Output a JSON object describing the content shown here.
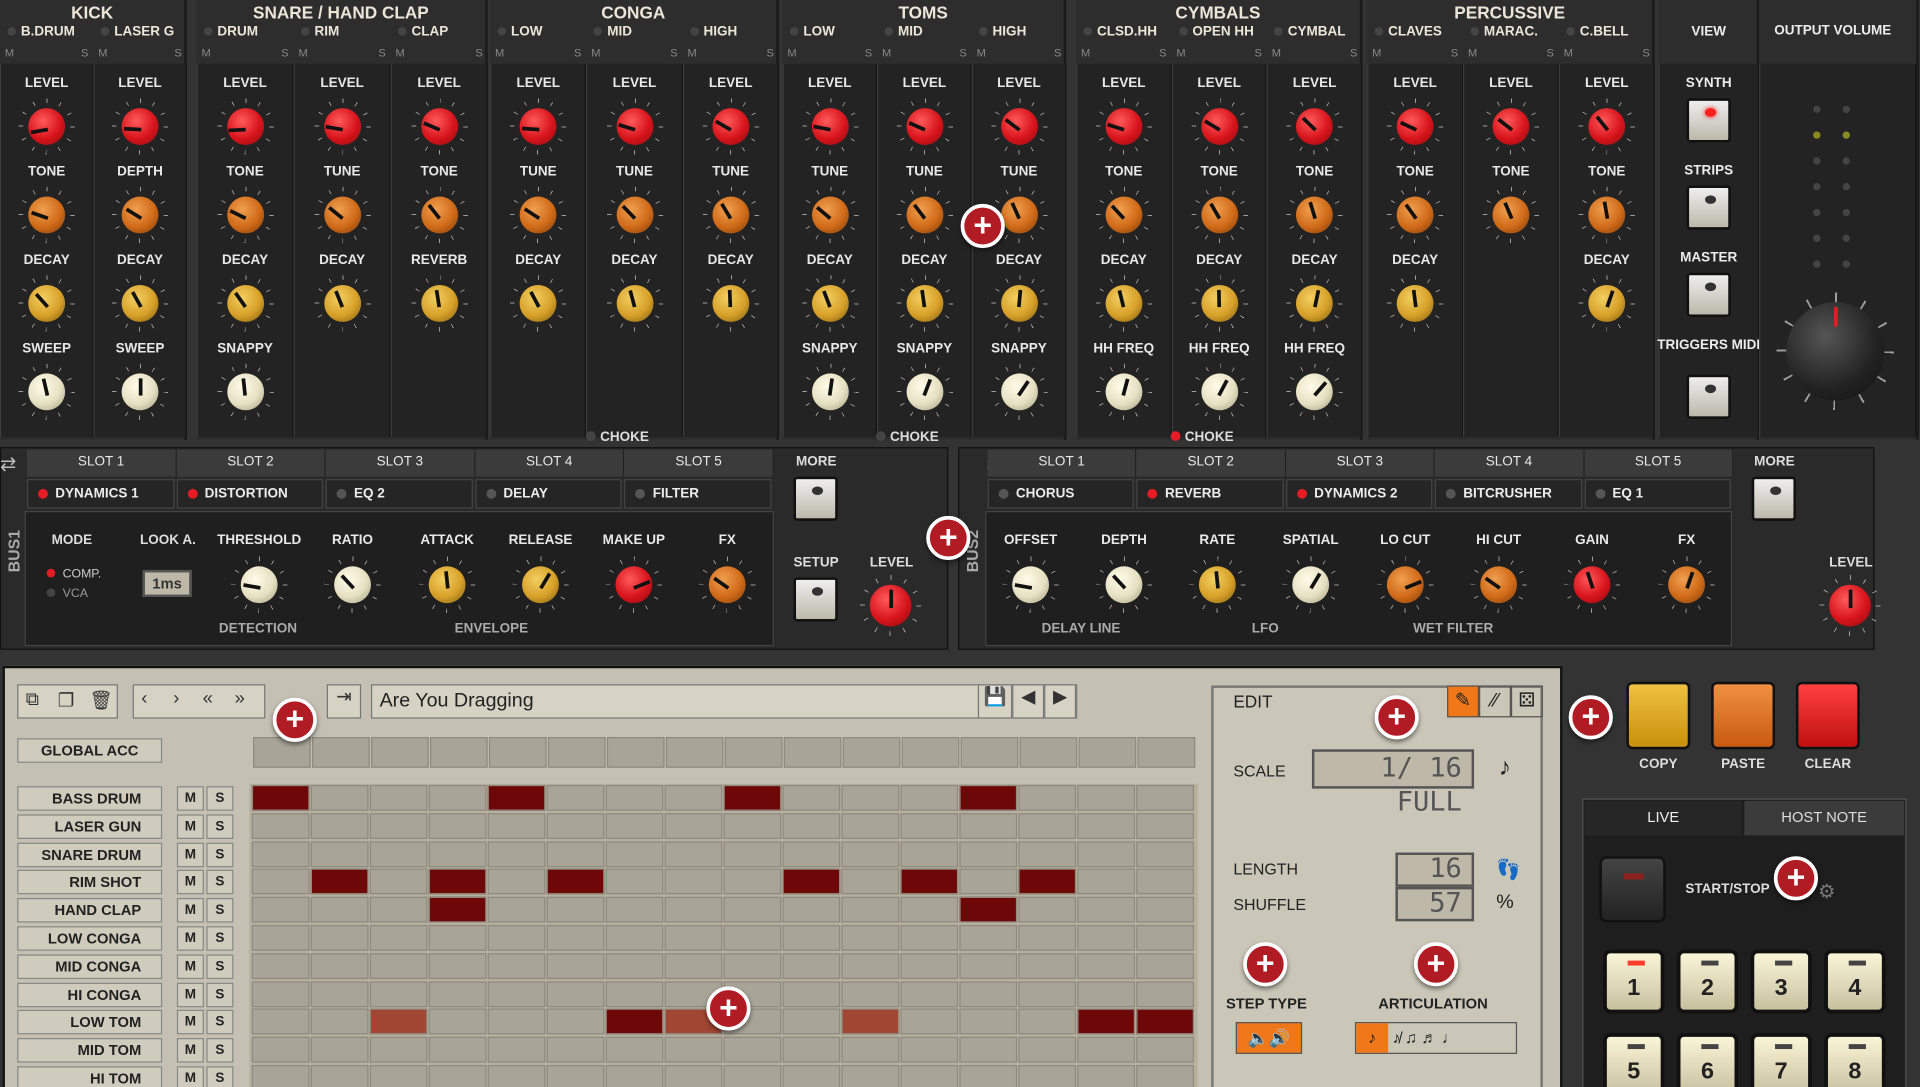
{
  "groups": [
    {
      "title": "KICK",
      "instruments": [
        {
          "name": "B.DRUM",
          "knobs": [
            "LEVEL",
            "TONE",
            "DECAY",
            "SWEEP"
          ]
        },
        {
          "name": "LASER G",
          "knobs": [
            "LEVEL",
            "DEPTH",
            "DECAY",
            "SWEEP"
          ]
        }
      ]
    },
    {
      "title": "SNARE / HAND CLAP",
      "instruments": [
        {
          "name": "DRUM",
          "knobs": [
            "LEVEL",
            "TONE",
            "DECAY",
            "SNAPPY"
          ]
        },
        {
          "name": "RIM",
          "knobs": [
            "LEVEL",
            "TUNE",
            "DECAY"
          ]
        },
        {
          "name": "CLAP",
          "knobs": [
            "LEVEL",
            "TONE",
            "REVERB"
          ]
        }
      ]
    },
    {
      "title": "CONGA",
      "instruments": [
        {
          "name": "LOW",
          "knobs": [
            "LEVEL",
            "TUNE",
            "DECAY"
          ]
        },
        {
          "name": "MID",
          "knobs": [
            "LEVEL",
            "TUNE",
            "DECAY"
          ]
        },
        {
          "name": "HIGH",
          "knobs": [
            "LEVEL",
            "TUNE",
            "DECAY"
          ]
        }
      ]
    },
    {
      "title": "TOMS",
      "instruments": [
        {
          "name": "LOW",
          "knobs": [
            "LEVEL",
            "TUNE",
            "DECAY",
            "SNAPPY"
          ]
        },
        {
          "name": "MID",
          "knobs": [
            "LEVEL",
            "TUNE",
            "DECAY",
            "SNAPPY"
          ]
        },
        {
          "name": "HIGH",
          "knobs": [
            "LEVEL",
            "TUNE",
            "DECAY",
            "SNAPPY"
          ]
        }
      ]
    },
    {
      "title": "CYMBALS",
      "instruments": [
        {
          "name": "CLSD.HH",
          "knobs": [
            "LEVEL",
            "TONE",
            "DECAY",
            "HH FREQ"
          ]
        },
        {
          "name": "OPEN HH",
          "knobs": [
            "LEVEL",
            "TONE",
            "DECAY",
            "HH FREQ"
          ]
        },
        {
          "name": "CYMBAL",
          "knobs": [
            "LEVEL",
            "TONE",
            "DECAY",
            "HH FREQ"
          ]
        }
      ]
    },
    {
      "title": "PERCUSSIVE",
      "instruments": [
        {
          "name": "CLAVES",
          "knobs": [
            "LEVEL",
            "TONE",
            "DECAY"
          ]
        },
        {
          "name": "MARAC.",
          "knobs": [
            "LEVEL",
            "TONE"
          ]
        },
        {
          "name": "C.BELL",
          "knobs": [
            "LEVEL",
            "TONE",
            "DECAY"
          ]
        }
      ]
    }
  ],
  "ms": {
    "m": "M",
    "s": "S"
  },
  "choke": "CHOKE",
  "view": {
    "title": "VIEW",
    "buttons": [
      "SYNTH",
      "STRIPS",
      "MASTER",
      "TRIGGERS MIDI"
    ]
  },
  "output": {
    "title": "OUTPUT VOLUME"
  },
  "bus1": {
    "label": "BUS1",
    "slots": [
      "SLOT 1",
      "SLOT 2",
      "SLOT 3",
      "SLOT 4",
      "SLOT 5"
    ],
    "effects": [
      "DYNAMICS 1",
      "DISTORTION",
      "EQ 2",
      "DELAY",
      "FILTER"
    ],
    "knobs": [
      "THRESHOLD",
      "RATIO",
      "ATTACK",
      "RELEASE",
      "MAKE UP",
      "FX"
    ],
    "mode": "MODE",
    "mode_opts": [
      "COMP.",
      "VCA"
    ],
    "look": "LOOK A.",
    "look_val": "1ms",
    "sections": [
      "DETECTION",
      "ENVELOPE"
    ],
    "more": "MORE",
    "setup": "SETUP",
    "level": "LEVEL"
  },
  "bus2": {
    "label": "BUS2",
    "slots": [
      "SLOT 1",
      "SLOT 2",
      "SLOT 3",
      "SLOT 4",
      "SLOT 5"
    ],
    "effects": [
      "CHORUS",
      "REVERB",
      "DYNAMICS 2",
      "BITCRUSHER",
      "EQ 1"
    ],
    "knobs": [
      "OFFSET",
      "DEPTH",
      "RATE",
      "SPATIAL",
      "LO CUT",
      "HI CUT",
      "GAIN",
      "FX"
    ],
    "sections": [
      "DELAY LINE",
      "LFO",
      "WET FILTER"
    ],
    "more": "MORE",
    "level": "LEVEL"
  },
  "seq": {
    "pattern_name": "Are You Dragging",
    "global_acc": "GLOBAL ACC",
    "tracks": [
      "BASS DRUM",
      "LASER GUN",
      "SNARE DRUM",
      "RIM SHOT",
      "HAND CLAP",
      "LOW CONGA",
      "MID CONGA",
      "HI CONGA",
      "LOW TOM",
      "MID TOM",
      "HI TOM"
    ],
    "steps": [
      [
        1,
        0,
        0,
        0,
        1,
        0,
        0,
        0,
        1,
        0,
        0,
        0,
        1,
        0,
        0,
        0
      ],
      [
        0,
        0,
        0,
        0,
        0,
        0,
        0,
        0,
        0,
        0,
        0,
        0,
        0,
        0,
        0,
        0
      ],
      [
        0,
        0,
        0,
        0,
        0,
        0,
        0,
        0,
        0,
        0,
        0,
        0,
        0,
        0,
        0,
        0
      ],
      [
        0,
        1,
        0,
        1,
        0,
        1,
        0,
        0,
        0,
        1,
        0,
        1,
        0,
        1,
        0,
        0
      ],
      [
        0,
        0,
        0,
        1,
        0,
        0,
        0,
        0,
        0,
        0,
        0,
        0,
        1,
        0,
        0,
        0
      ],
      [
        0,
        0,
        0,
        0,
        0,
        0,
        0,
        0,
        0,
        0,
        0,
        0,
        0,
        0,
        0,
        0
      ],
      [
        0,
        0,
        0,
        0,
        0,
        0,
        0,
        0,
        0,
        0,
        0,
        0,
        0,
        0,
        0,
        0
      ],
      [
        0,
        0,
        0,
        0,
        0,
        0,
        0,
        0,
        0,
        0,
        0,
        0,
        0,
        0,
        0,
        0
      ],
      [
        0,
        0,
        2,
        0,
        0,
        0,
        1,
        2,
        0,
        0,
        2,
        0,
        0,
        0,
        1,
        1
      ],
      [
        0,
        0,
        0,
        0,
        0,
        0,
        0,
        0,
        0,
        0,
        0,
        0,
        0,
        0,
        0,
        0
      ],
      [
        0,
        0,
        0,
        0,
        0,
        0,
        0,
        0,
        0,
        0,
        0,
        0,
        0,
        0,
        0,
        0
      ]
    ]
  },
  "edit": {
    "title": "EDIT",
    "scale_label": "SCALE",
    "scale_val": "1/ 16 FULL",
    "length_label": "LENGTH",
    "length_val": "16",
    "shuffle_label": "SHUFFLE",
    "shuffle_val": "57",
    "step_type": "STEP TYPE",
    "articulation": "ARTICULATION"
  },
  "actions": {
    "copy": "COPY",
    "paste": "PASTE",
    "clear": "CLEAR"
  },
  "live": {
    "tab1": "LIVE",
    "tab2": "HOST NOTE",
    "startstop": "START/STOP",
    "pads": [
      "1",
      "2",
      "3",
      "4",
      "5",
      "6",
      "7",
      "8"
    ]
  },
  "colors": {
    "knob_red": "#d8141b",
    "knob_orange": "#d06a18",
    "knob_gold": "#d7a028",
    "knob_cream": "#e6e0c2",
    "step_on": "#6e0808",
    "accent": "#b11c24"
  }
}
